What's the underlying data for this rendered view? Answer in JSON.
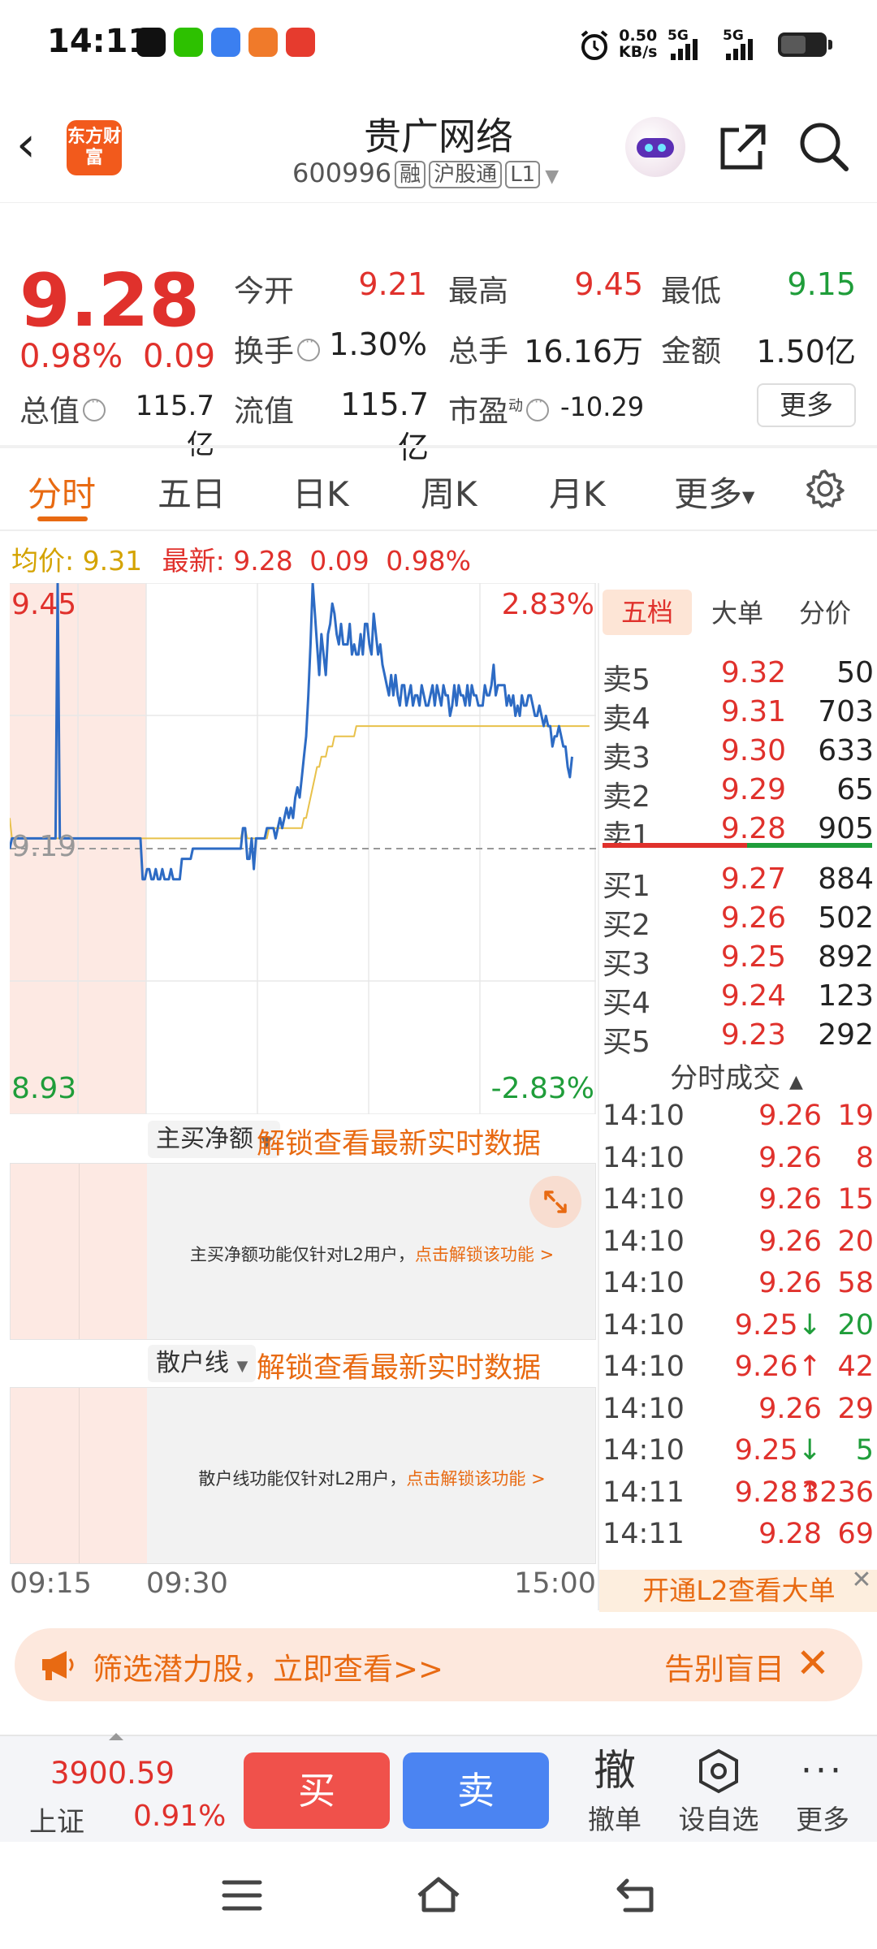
{
  "status_bar": {
    "time": "14:11",
    "net_rate": "0.50",
    "net_unit": "KB/s",
    "sim1": "5G",
    "sim2": "5G"
  },
  "header": {
    "logo": "东方财富",
    "stock_name": "贵广网络",
    "stock_code": "600996",
    "tags": [
      "融",
      "沪股通",
      "L1"
    ]
  },
  "quote": {
    "last_price": "9.28",
    "change_pct": "0.98%",
    "change": "0.09",
    "open_label": "今开",
    "open": "9.21",
    "high_label": "最高",
    "high": "9.45",
    "low_label": "最低",
    "low": "9.15",
    "turnover_label": "换手",
    "turnover": "1.30%",
    "volume_label": "总手",
    "volume": "16.16万",
    "amount_label": "金额",
    "amount": "1.50亿",
    "mktcap_label": "总值",
    "mktcap": "115.7亿",
    "float_label": "流值",
    "float_cap": "115.7亿",
    "pe_label": "市盈",
    "pe_sup": "动",
    "pe": "-10.29",
    "more": "更多"
  },
  "chart_tabs": [
    "分时",
    "五日",
    "日K",
    "周K",
    "月K",
    "更多"
  ],
  "avg_bar": {
    "avg_label": "均价:",
    "avg": "9.31",
    "latest_label": "最新:",
    "latest": "9.28",
    "chg": "0.09",
    "pct": "0.98%"
  },
  "chart_labels": {
    "high": "9.45",
    "high_pct": "2.83%",
    "mid": "9.19",
    "low": "8.93",
    "low_pct": "-2.83%"
  },
  "chart_data": {
    "type": "line",
    "ylim": [
      8.93,
      9.45
    ],
    "reference_price": 9.19,
    "x": [
      "09:15",
      "09:30",
      "15:00"
    ],
    "series": [
      {
        "name": "",
        "color": "#2d6bc4",
        "values": [
          9.19,
          9.2,
          9.2,
          9.2,
          9.2,
          9.2,
          9.2,
          9.2,
          9.2,
          9.2,
          9.2,
          9.2,
          9.2,
          9.2,
          9.2,
          9.2,
          9.2,
          9.2,
          9.2,
          9.2,
          9.2,
          9.2,
          9.45,
          9.2,
          9.2,
          9.2,
          9.2,
          9.2,
          9.2,
          9.2,
          9.2,
          9.2,
          9.2,
          9.2,
          9.2,
          9.2,
          9.2,
          9.2,
          9.2,
          9.2,
          9.2,
          9.2,
          9.2,
          9.2,
          9.2,
          9.2,
          9.2,
          9.2,
          9.2,
          9.2,
          9.2,
          9.2,
          9.2,
          9.2,
          9.2,
          9.2,
          9.2,
          9.2,
          9.2,
          9.2,
          9.2,
          9.16,
          9.16,
          9.17,
          9.17,
          9.16,
          9.16,
          9.17,
          9.16,
          9.16,
          9.17,
          9.16,
          9.16,
          9.16,
          9.17,
          9.16,
          9.16,
          9.16,
          9.16,
          9.18,
          9.18,
          9.18,
          9.18,
          9.18,
          9.19,
          9.19,
          9.19,
          9.19,
          9.19,
          9.19,
          9.19,
          9.19,
          9.19,
          9.19,
          9.19,
          9.19,
          9.19,
          9.19,
          9.19,
          9.19,
          9.19,
          9.19,
          9.19,
          9.19,
          9.19,
          9.19,
          9.19,
          9.21,
          9.21,
          9.18,
          9.18,
          9.2,
          9.17,
          9.2,
          9.2,
          9.2,
          9.2,
          9.2,
          9.21,
          9.21,
          9.21,
          9.21,
          9.2,
          9.21,
          9.22,
          9.21,
          9.22,
          9.23,
          9.22,
          9.23,
          9.22,
          9.24,
          9.25,
          9.24,
          9.26,
          9.28,
          9.3,
          9.34,
          9.39,
          9.45,
          9.42,
          9.39,
          9.36,
          9.4,
          9.38,
          9.36,
          9.4,
          9.41,
          9.43,
          9.42,
          9.4,
          9.39,
          9.41,
          9.39,
          9.39,
          9.39,
          9.41,
          9.38,
          9.39,
          9.38,
          9.38,
          9.4,
          9.38,
          9.41,
          9.41,
          9.39,
          9.38,
          9.42,
          9.4,
          9.38,
          9.39,
          9.37,
          9.36,
          9.35,
          9.34,
          9.36,
          9.34,
          9.36,
          9.34,
          9.33,
          9.35,
          9.35,
          9.33,
          9.34,
          9.35,
          9.33,
          9.34,
          9.34,
          9.33,
          9.35,
          9.34,
          9.33,
          9.33,
          9.34,
          9.35,
          9.33,
          9.35,
          9.34,
          9.33,
          9.35,
          9.34,
          9.34,
          9.32,
          9.33,
          9.35,
          9.33,
          9.35,
          9.34,
          9.34,
          9.33,
          9.35,
          9.33,
          9.35,
          9.34,
          9.34,
          9.33,
          9.33,
          9.33,
          9.35,
          9.34,
          9.34,
          9.35,
          9.37,
          9.34,
          9.35,
          9.35,
          9.35,
          9.35,
          9.33,
          9.34,
          9.33,
          9.34,
          9.32,
          9.33,
          9.32,
          9.34,
          9.33,
          9.33,
          9.34,
          9.34,
          9.33,
          9.32,
          9.32,
          9.33,
          9.32,
          9.31,
          9.32,
          9.31,
          9.31,
          9.29,
          9.3,
          9.3,
          9.31,
          9.3,
          9.29,
          9.29,
          9.27,
          9.26,
          9.28
        ]
      },
      {
        "name": "",
        "color": "#e8c14a",
        "values": [
          9.22,
          9.2,
          9.2,
          9.2,
          9.2,
          9.2,
          9.2,
          9.2,
          9.2,
          9.2,
          9.2,
          9.2,
          9.2,
          9.2,
          9.2,
          9.2,
          9.2,
          9.2,
          9.2,
          9.2,
          9.2,
          9.2,
          9.2,
          9.2,
          9.2,
          9.2,
          9.2,
          9.2,
          9.2,
          9.2,
          9.2,
          9.2,
          9.2,
          9.2,
          9.2,
          9.2,
          9.2,
          9.2,
          9.2,
          9.2,
          9.2,
          9.2,
          9.2,
          9.2,
          9.2,
          9.2,
          9.2,
          9.2,
          9.2,
          9.2,
          9.2,
          9.2,
          9.2,
          9.2,
          9.2,
          9.2,
          9.2,
          9.2,
          9.2,
          9.2,
          9.2,
          9.2,
          9.2,
          9.2,
          9.2,
          9.2,
          9.2,
          9.2,
          9.2,
          9.2,
          9.2,
          9.2,
          9.2,
          9.2,
          9.2,
          9.2,
          9.2,
          9.2,
          9.2,
          9.2,
          9.2,
          9.2,
          9.2,
          9.2,
          9.2,
          9.2,
          9.2,
          9.2,
          9.2,
          9.2,
          9.2,
          9.2,
          9.2,
          9.2,
          9.2,
          9.2,
          9.2,
          9.2,
          9.2,
          9.2,
          9.2,
          9.2,
          9.2,
          9.2,
          9.2,
          9.2,
          9.2,
          9.21,
          9.21,
          9.2,
          9.2,
          9.2,
          9.2,
          9.2,
          9.2,
          9.2,
          9.2,
          9.2,
          9.2,
          9.21,
          9.21,
          9.21,
          9.21,
          9.21,
          9.21,
          9.21,
          9.21,
          9.21,
          9.21,
          9.21,
          9.21,
          9.21,
          9.21,
          9.21,
          9.21,
          9.22,
          9.22,
          9.23,
          9.24,
          9.25,
          9.26,
          9.27,
          9.27,
          9.28,
          9.28,
          9.28,
          9.29,
          9.29,
          9.29,
          9.3,
          9.3,
          9.3,
          9.3,
          9.3,
          9.3,
          9.3,
          9.3,
          9.3,
          9.3,
          9.31,
          9.31,
          9.31,
          9.31,
          9.31,
          9.31,
          9.31,
          9.31,
          9.31,
          9.31,
          9.31,
          9.31,
          9.31,
          9.31,
          9.31,
          9.31,
          9.31,
          9.31,
          9.31,
          9.31,
          9.31,
          9.31,
          9.31,
          9.31,
          9.31,
          9.31,
          9.31,
          9.31,
          9.31,
          9.31,
          9.31,
          9.31,
          9.31,
          9.31,
          9.31,
          9.31,
          9.31,
          9.31,
          9.31,
          9.31,
          9.31,
          9.31,
          9.31,
          9.31,
          9.31,
          9.31,
          9.31,
          9.31,
          9.31,
          9.31,
          9.31,
          9.31,
          9.31,
          9.31,
          9.31,
          9.31,
          9.31,
          9.31,
          9.31,
          9.31,
          9.31,
          9.31,
          9.31,
          9.31,
          9.31,
          9.31,
          9.31,
          9.31,
          9.31,
          9.31,
          9.31,
          9.31,
          9.31,
          9.31,
          9.31,
          9.31,
          9.31,
          9.31,
          9.31,
          9.31,
          9.31,
          9.31,
          9.31,
          9.31,
          9.31,
          9.31,
          9.31,
          9.31,
          9.31,
          9.31,
          9.31,
          9.31,
          9.31,
          9.31,
          9.31,
          9.31,
          9.31,
          9.31,
          9.31,
          9.31,
          9.31,
          9.31,
          9.31,
          9.31,
          9.31,
          9.31,
          9.31,
          9.31
        ]
      }
    ]
  },
  "orderbook": {
    "tabs": [
      "五档",
      "大单",
      "分价"
    ],
    "asks": [
      {
        "name": "卖5",
        "price": "9.32",
        "vol": "50"
      },
      {
        "name": "卖4",
        "price": "9.31",
        "vol": "703"
      },
      {
        "name": "卖3",
        "price": "9.30",
        "vol": "633"
      },
      {
        "name": "卖2",
        "price": "9.29",
        "vol": "65"
      },
      {
        "name": "卖1",
        "price": "9.28",
        "vol": "905"
      }
    ],
    "bids": [
      {
        "name": "买1",
        "price": "9.27",
        "vol": "884"
      },
      {
        "name": "买2",
        "price": "9.26",
        "vol": "502"
      },
      {
        "name": "买3",
        "price": "9.25",
        "vol": "892"
      },
      {
        "name": "买4",
        "price": "9.24",
        "vol": "123"
      },
      {
        "name": "买5",
        "price": "9.23",
        "vol": "292"
      }
    ],
    "ticks_title": "分时成交",
    "ticks": [
      {
        "time": "14:10",
        "price": "9.26",
        "vol": "19",
        "dir": ""
      },
      {
        "time": "14:10",
        "price": "9.26",
        "vol": "8",
        "dir": ""
      },
      {
        "time": "14:10",
        "price": "9.26",
        "vol": "15",
        "dir": ""
      },
      {
        "time": "14:10",
        "price": "9.26",
        "vol": "20",
        "dir": ""
      },
      {
        "time": "14:10",
        "price": "9.26",
        "vol": "58",
        "dir": ""
      },
      {
        "time": "14:10",
        "price": "9.25",
        "vol": "20",
        "dir": "down"
      },
      {
        "time": "14:10",
        "price": "9.26",
        "vol": "42",
        "dir": "up"
      },
      {
        "time": "14:10",
        "price": "9.26",
        "vol": "29",
        "dir": ""
      },
      {
        "time": "14:10",
        "price": "9.25",
        "vol": "5",
        "dir": "down"
      },
      {
        "time": "14:11",
        "price": "9.28",
        "vol": "3236",
        "dir": "up"
      },
      {
        "time": "14:11",
        "price": "9.28",
        "vol": "69",
        "dir": ""
      }
    ],
    "l2_banner": "开通L2查看大单"
  },
  "panels": {
    "p1_select": "主买净额",
    "p1_unlock": "解锁查看最新实时数据",
    "p1_msg": "主买净额功能仅针对L2用户，",
    "p1_link": "点击解锁该功能 >",
    "p2_select": "散户线",
    "p2_unlock": "解锁查看最新实时数据",
    "p2_msg": "散户线功能仅针对L2用户，",
    "p2_link": "点击解锁该功能 >"
  },
  "time_axis": [
    "09:15",
    "09:30",
    "15:00"
  ],
  "ad": {
    "text": "筛选潜力股，立即查看>>",
    "text2": "告别盲目"
  },
  "bottom": {
    "index_value": "3900.59",
    "index_name": "上证",
    "index_pct": "0.91%",
    "buy": "买",
    "sell": "卖",
    "cancel_icon": "撤",
    "cancel": "撤单",
    "watch": "设自选",
    "more": "更多"
  },
  "colors": {
    "up": "#e0312c",
    "down": "#1f9d3a",
    "accent": "#e86a12",
    "price_line": "#2d6bc4",
    "avg_line": "#e8c14a"
  }
}
